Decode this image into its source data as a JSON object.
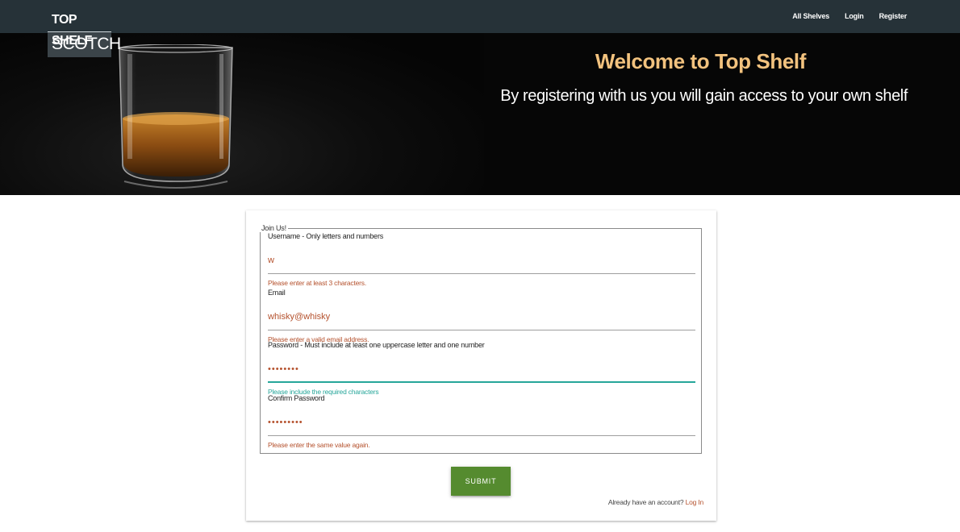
{
  "nav": {
    "logo_top": "TOP SHELF",
    "logo_bottom": "SCOTCH",
    "links": [
      "All Shelves",
      "Login",
      "Register"
    ]
  },
  "hero": {
    "title": "Welcome to Top Shelf",
    "subtitle": "By registering with us you will gain access to your own shelf"
  },
  "form": {
    "legend": "Join Us!",
    "fields": [
      {
        "label": "Username - Only letters and numbers",
        "value": "w",
        "error": "Please enter at least 3 characters."
      },
      {
        "label": "Email",
        "value": "whisky@whisky",
        "error": "Please enter a valid email address."
      },
      {
        "label": "Password - Must include at least one uppercase letter and one number",
        "value": "••••••••",
        "error": "Please include the required characters"
      },
      {
        "label": "Confirm Password",
        "value": "•••••••••",
        "error": "Please enter the same value again."
      }
    ],
    "submit_label": "Submit",
    "already_text": "Already have an account?",
    "login_link": "Log In"
  },
  "colors": {
    "navbar": "#263238",
    "accent_gold": "#f2c27e",
    "error": "#b5522e",
    "valid": "#26a69a",
    "submit": "#558b2f"
  }
}
